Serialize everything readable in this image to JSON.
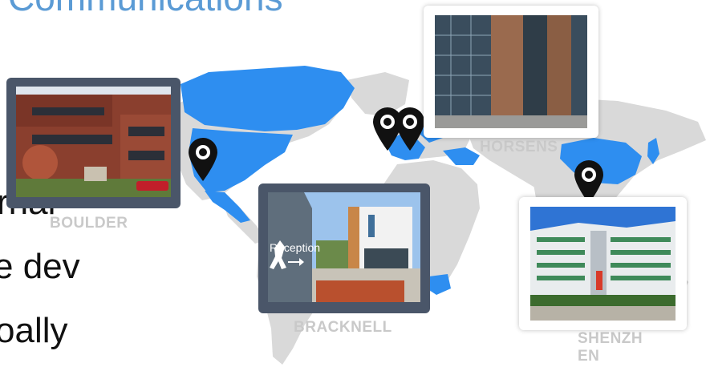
{
  "slide": {
    "title": "Communications",
    "bullets": [
      "rnal",
      "e dev",
      "oally"
    ]
  },
  "map": {
    "land_color": "#d9d9d9",
    "highlight_color": "#2e8ef0",
    "cities": {
      "boulder": "BOULDER",
      "bracknell": "BRACKNELL",
      "horsens": "HORSENS",
      "shenzhen": "SHENZH EN"
    },
    "pin_icon": "map-marker-icon"
  },
  "photos": {
    "boulder": "office-building-boulder",
    "bracknell": "office-building-bracknell",
    "horsens": "office-building-horsens",
    "shenzhen": "office-building-shenzhen"
  },
  "signs": {
    "reception": "Reception"
  },
  "colors": {
    "title": "#5b9bd5",
    "dark_frame": "#4a5669",
    "city_label": "#c9c9c9"
  }
}
